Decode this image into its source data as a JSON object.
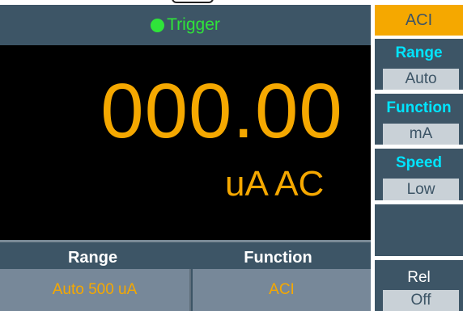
{
  "header": {
    "cropped_text": "(cropped)"
  },
  "status": {
    "text": "Trigger",
    "dot_color": "#2fe43a"
  },
  "reading": {
    "value": "000.00",
    "unit": "uA AC",
    "color": "#f5a800"
  },
  "info": {
    "range_label": "Range",
    "function_label": "Function",
    "range_value": "Auto 500 uA",
    "function_value": "ACI"
  },
  "softkeys": {
    "mode": "ACI",
    "range": {
      "title": "Range",
      "value": "Auto"
    },
    "function": {
      "title": "Function",
      "value": "mA"
    },
    "speed": {
      "title": "Speed",
      "value": "Low"
    },
    "rel": {
      "title": "Rel",
      "value": "Off"
    }
  },
  "colors": {
    "panel": "#3d5566",
    "accent": "#f5a800",
    "softkey_title": "#00e5ff",
    "softkey_value_bg": "#c9d1d7",
    "display_bg": "#000000"
  }
}
